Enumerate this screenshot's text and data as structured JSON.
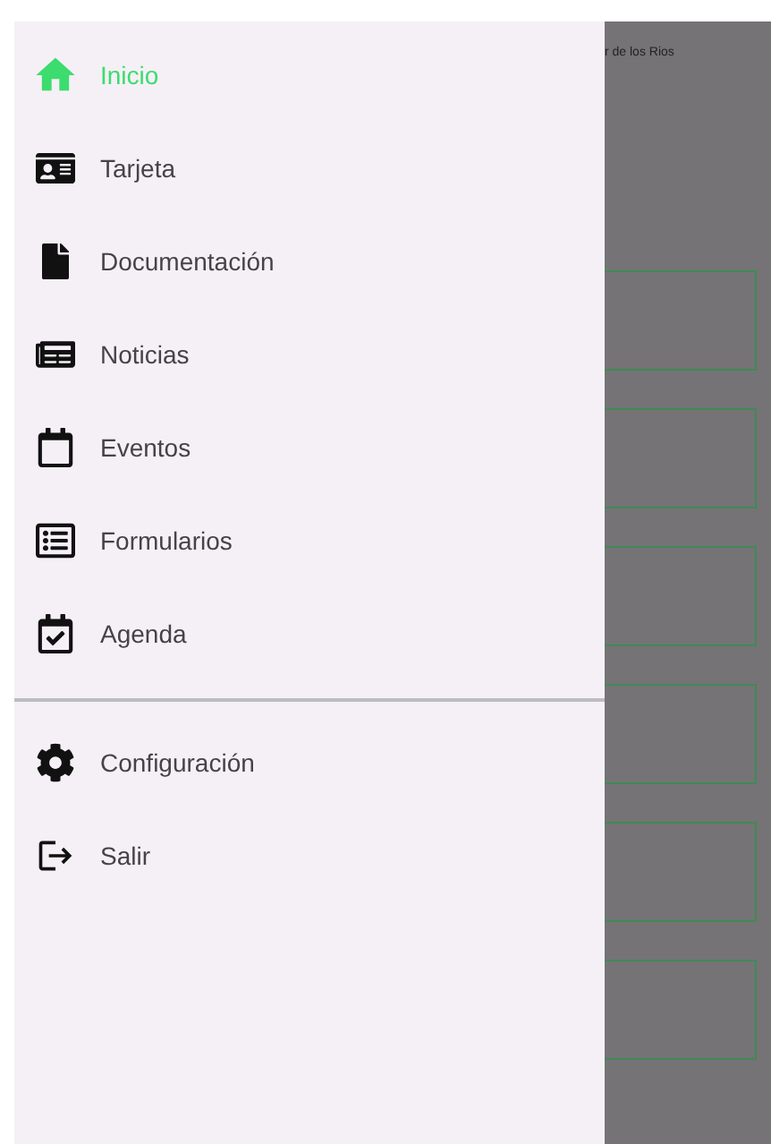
{
  "drawer": {
    "items": [
      {
        "kind": "home",
        "label": "Inicio",
        "selected": true
      },
      {
        "kind": "card",
        "label": "Tarjeta",
        "selected": false
      },
      {
        "kind": "document",
        "label": "Documentación",
        "selected": false
      },
      {
        "kind": "news",
        "label": "Noticias",
        "selected": false
      },
      {
        "kind": "calendar",
        "label": "Eventos",
        "selected": false
      },
      {
        "kind": "form",
        "label": "Formularios",
        "selected": false
      },
      {
        "kind": "agenda",
        "label": "Agenda",
        "selected": false
      }
    ],
    "footer_items": [
      {
        "kind": "settings",
        "label": "Configuración",
        "selected": false
      },
      {
        "kind": "logout",
        "label": "Salir",
        "selected": false
      }
    ]
  },
  "background": {
    "subtitle": "r de los Rios"
  }
}
